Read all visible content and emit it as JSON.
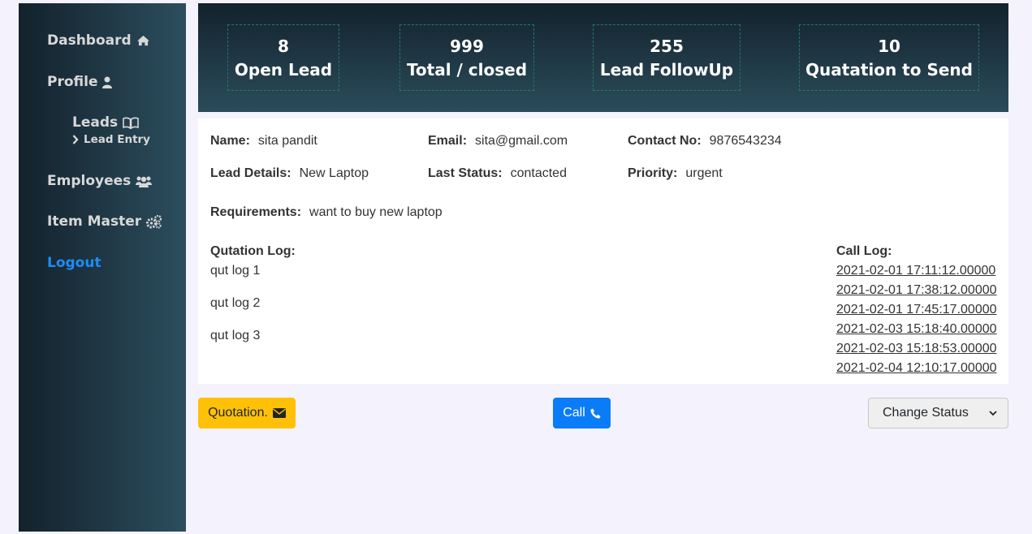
{
  "sidebar": {
    "items": [
      {
        "label": "Dashboard",
        "icon": "home-icon"
      },
      {
        "label": "Profile",
        "icon": "user-icon"
      },
      {
        "label": "Leads",
        "icon": "book-icon"
      },
      {
        "label": "Employees",
        "icon": "users-icon"
      },
      {
        "label": "Item Master",
        "icon": "cogs-icon"
      },
      {
        "label": "Logout",
        "icon": ""
      }
    ],
    "sub_item": {
      "label": "Lead Entry",
      "icon": "chevron-right-icon"
    },
    "colors": {
      "text": "#d8d8d8",
      "logout": "#1e8cf5"
    }
  },
  "stats": [
    {
      "value": "8",
      "label": "Open Lead"
    },
    {
      "value": "999",
      "label": "Total / closed"
    },
    {
      "value": "255",
      "label": "Lead FollowUp"
    },
    {
      "value": "10",
      "label": "Quatation to Send"
    }
  ],
  "details": {
    "name_label": "Name:",
    "name": "sita pandit",
    "email_label": "Email:",
    "email": "sita@gmail.com",
    "contact_label": "Contact No:",
    "contact": "9876543234",
    "lead_details_label": "Lead Details:",
    "lead_details": "New Laptop",
    "last_status_label": "Last Status:",
    "last_status": "contacted",
    "priority_label": "Priority:",
    "priority": "urgent",
    "requirements_label": "Requirements:",
    "requirements": "want to buy new laptop"
  },
  "quotation_log": {
    "title": "Qutation Log:",
    "items": [
      "qut log 1",
      "qut log 2",
      "qut log 3"
    ]
  },
  "call_log": {
    "title": "Call Log:",
    "items": [
      "2021-02-01 17:11:12.00000",
      "2021-02-01 17:38:12.00000",
      "2021-02-01 17:45:17.00000",
      "2021-02-03 15:18:40.00000",
      "2021-02-03 15:18:53.00000",
      "2021-02-04 12:10:17.00000"
    ]
  },
  "actions": {
    "quotation_label": "Quotation.",
    "call_label": "Call",
    "status_select": "Change Status",
    "colors": {
      "quotation": "#ffc107",
      "call": "#0a7cf8"
    }
  }
}
